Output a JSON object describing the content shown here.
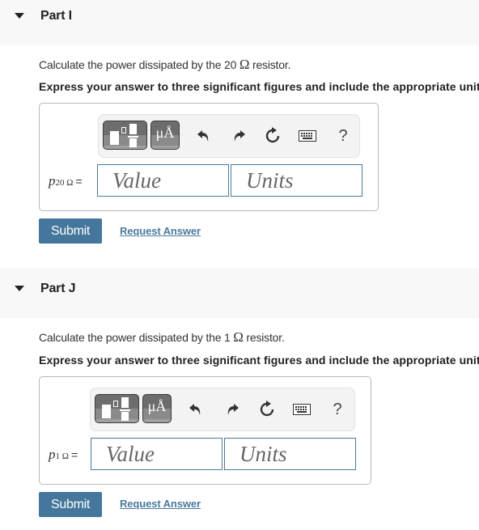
{
  "parts": [
    {
      "title": "Part I",
      "prompt_before": "Calculate the power dissipated by the 20 ",
      "prompt_symbol": "Ω",
      "prompt_after": " resistor.",
      "instruction": "Express your answer to three significant figures and include the appropriate units.",
      "variable": "p",
      "variable_subscript": "20 Ω",
      "equals": "=",
      "value_placeholder": "Value",
      "units_placeholder": "Units",
      "submit_label": "Submit",
      "request_answer_label": "Request Answer"
    },
    {
      "title": "Part J",
      "prompt_before": "Calculate the power dissipated by the 1 ",
      "prompt_symbol": "Ω",
      "prompt_after": " resistor.",
      "instruction": "Express your answer to three significant figures and include the appropriate units.",
      "variable": "p",
      "variable_subscript": "1 Ω",
      "equals": "=",
      "value_placeholder": "Value",
      "units_placeholder": "Units",
      "submit_label": "Submit",
      "request_answer_label": "Request Answer"
    }
  ],
  "toolbar": {
    "templates_icon": "templates-icon",
    "units_glyph": "μÅ",
    "undo_icon": "undo-icon",
    "redo_icon": "redo-icon",
    "reset_icon": "reset-icon",
    "keyboard_icon": "keyboard-icon",
    "help_label": "?"
  },
  "colors": {
    "accent": "#44779b",
    "link": "#4a7a9c",
    "header_bg": "#f8f8f8",
    "toolbar_button": "#6d6d6d"
  }
}
